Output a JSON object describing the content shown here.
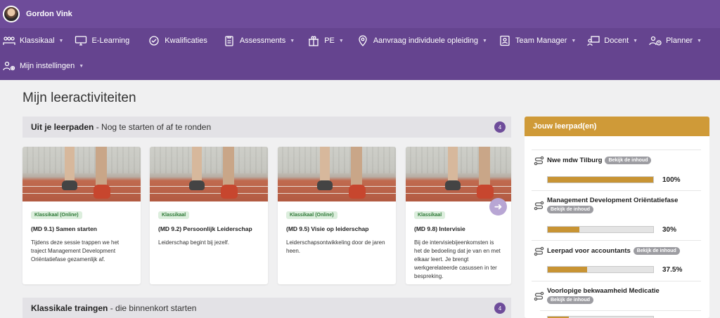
{
  "user": {
    "name": "Gordon Vink"
  },
  "nav": {
    "row1": [
      {
        "label": "Klassikaal",
        "icon": "classroom-icon",
        "caret": true
      },
      {
        "label": "E-Learning",
        "icon": "monitor-icon",
        "caret": false
      },
      {
        "label": "Kwalificaties",
        "icon": "badge-check-icon",
        "caret": false
      },
      {
        "label": "Assessments",
        "icon": "clipboard-icon",
        "caret": true
      },
      {
        "label": "PE",
        "icon": "gift-icon",
        "caret": true
      },
      {
        "label": "Aanvraag individuele opleiding",
        "icon": "map-pin-icon",
        "caret": true
      },
      {
        "label": "Team Manager",
        "icon": "id-card-icon",
        "caret": true
      },
      {
        "label": "Docent",
        "icon": "teacher-icon",
        "caret": true
      },
      {
        "label": "Planner",
        "icon": "person-clock-icon",
        "caret": true
      }
    ],
    "row2": [
      {
        "label": "Mijn instellingen",
        "icon": "user-settings-icon",
        "caret": true
      }
    ]
  },
  "page": {
    "title": "Mijn leeractiviteiten"
  },
  "section1": {
    "title": "Uit je leerpaden",
    "subtitle": " - Nog te starten of af te ronden",
    "count": "4"
  },
  "cards": [
    {
      "tag": "Klassikaal (Online)",
      "title": "(MD 9.1) Samen starten",
      "desc": "Tijdens deze sessie trappen we het traject Management Development Oriëntatiefase gezamenlijk af."
    },
    {
      "tag": "Klassikaal",
      "title": "(MD 9.2) Persoonlijk Leiderschap",
      "desc": "Leiderschap begint bij jezelf."
    },
    {
      "tag": "Klassikaal (Online)",
      "title": "(MD 9.5) Visie op leiderschap",
      "desc": "Leiderschapsontwikkeling door de jaren heen."
    },
    {
      "tag": "Klassikaal",
      "title": "(MD 9.8) Intervisie",
      "desc": "Bij de intervisiebijeenkomsten is het de bedoeling dat je van en met elkaar leert. Je brengt werkgerelateerde casussen in ter bespreking."
    }
  ],
  "section2": {
    "title": "Klassikale traingen",
    "subtitle": " - die binnenkort starten",
    "count": "4"
  },
  "learning_paths": {
    "header": "Jouw leerpad(en)",
    "view_label": "Bekijk de inhoud",
    "items": [
      {
        "title": "Nwe mdw Tilburg",
        "progress": 100,
        "pct_label": "100%"
      },
      {
        "title": "Management Development Oriëntatiefase",
        "progress": 30,
        "pct_label": "30%"
      },
      {
        "title": "Leerpad voor accountants",
        "progress": 37.5,
        "pct_label": "37.5%"
      },
      {
        "title": "Voorlopige bekwaamheid Medicatie",
        "progress": 20,
        "pct_label": ""
      }
    ]
  },
  "colors": {
    "header": "#6e4c9a",
    "nav": "#65448f",
    "accent": "#cf9a38",
    "progress": "#c89434"
  }
}
